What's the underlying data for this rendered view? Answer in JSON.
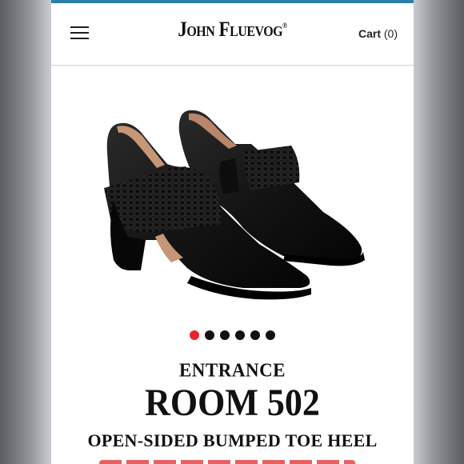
{
  "header": {
    "logo_text": "John Fluevog",
    "logo_mark": "®",
    "cart_label": "Cart",
    "cart_count": "(0)"
  },
  "product": {
    "image_icon": "black-leather-ankle-boot-pair",
    "gallery": {
      "total_images": 6,
      "active_index": 0
    },
    "collection": "ENTRANCE",
    "name": "ROOM 502",
    "description": "OPEN-SIDED BUMPED TOE HEEL"
  },
  "colors": {
    "accent_bar": "#2c7fa3",
    "active_dot": "#e8262c",
    "inactive_dot": "#111111"
  }
}
